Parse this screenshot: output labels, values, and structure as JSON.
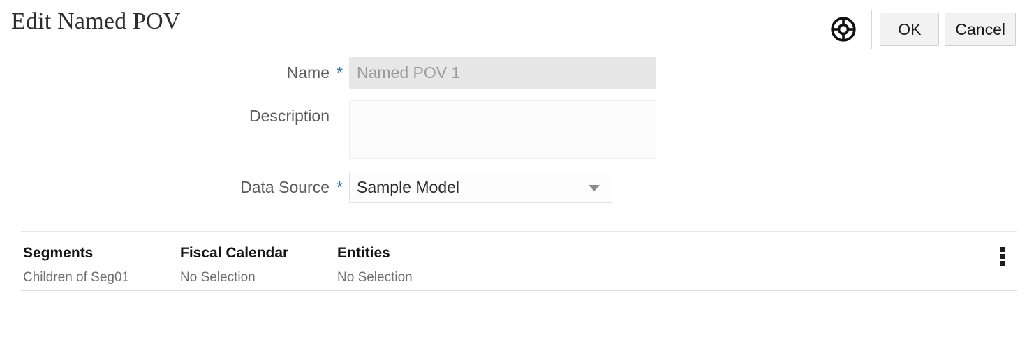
{
  "header": {
    "title": "Edit Named POV",
    "help_icon": "life-ring-icon",
    "ok_label": "OK",
    "cancel_label": "Cancel"
  },
  "form": {
    "name": {
      "label": "Name",
      "required": true,
      "required_marker": "*",
      "value": "Named POV 1",
      "placeholder": "Named POV 1",
      "disabled": true
    },
    "description": {
      "label": "Description",
      "required": false,
      "required_marker": "*",
      "value": "",
      "placeholder": ""
    },
    "data_source": {
      "label": "Data Source",
      "required": true,
      "required_marker": "*",
      "value": "Sample Model",
      "options": [
        "Sample Model"
      ],
      "dropdown_icon": "chevron-down-icon"
    }
  },
  "pov_table": {
    "columns": [
      {
        "header": "Segments",
        "value": "Children of Seg01"
      },
      {
        "header": "Fiscal Calendar",
        "value": "No Selection"
      },
      {
        "header": "Entities",
        "value": "No Selection"
      }
    ],
    "menu_icon": "more-vertical-icon"
  },
  "colors": {
    "required_asterisk": "#2c6fad",
    "title_text": "#2f2f2f",
    "label_text": "#5b5b5b",
    "disabled_field_bg": "#e7e7e7",
    "button_bg": "#f2f2f2",
    "divider": "#e6e6e6"
  }
}
